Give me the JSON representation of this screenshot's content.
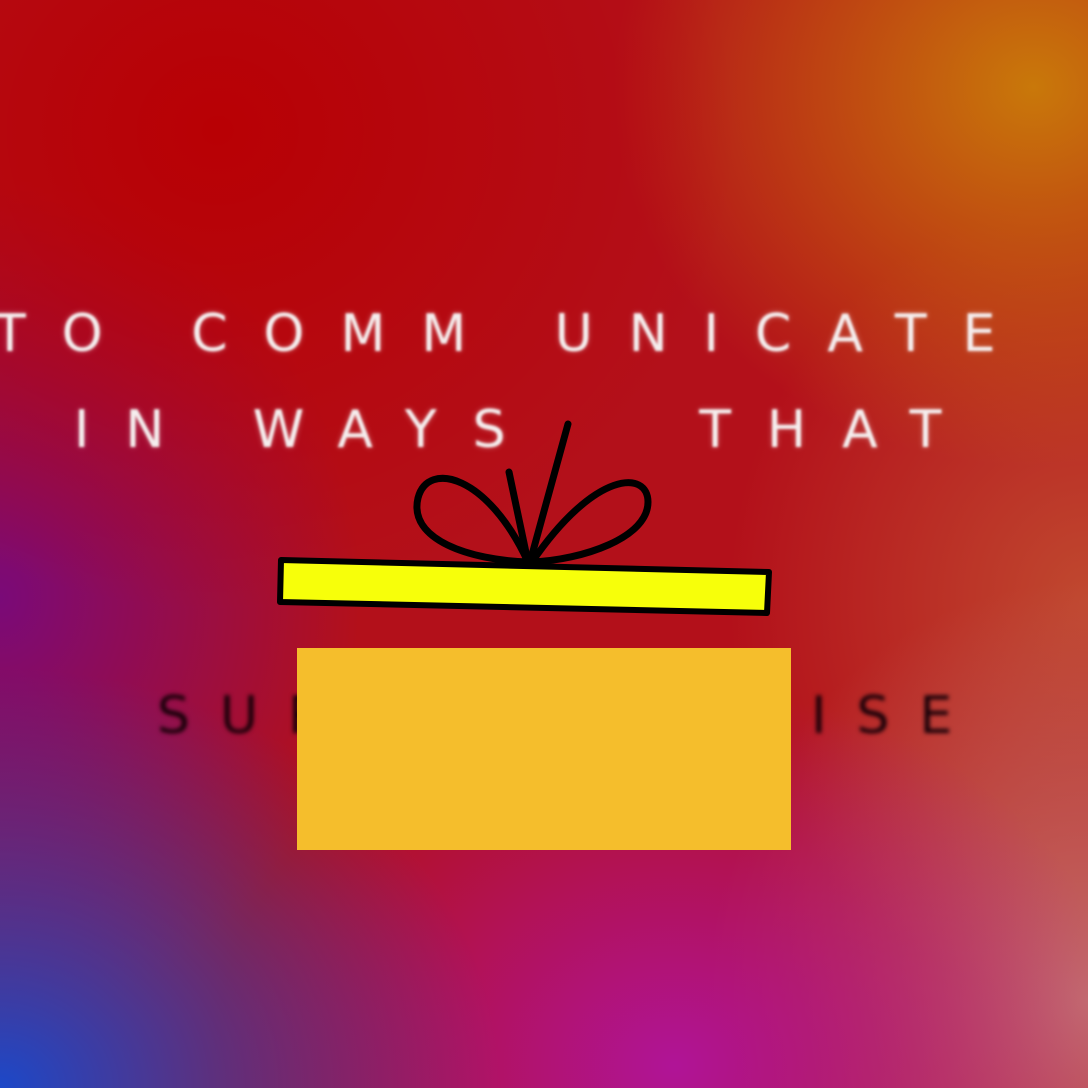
{
  "scene": {
    "line1": "TO COMM UNICATE",
    "line2": "IN WAYS   THAT",
    "word_left": "SURP",
    "word_right": "RISE"
  },
  "colors": {
    "background_top": "#b80004",
    "background_top_right": "#c9780a",
    "background_bottom_left": "#1c48c8",
    "background_bottom": "#b01497",
    "lid_fill": "#f7ff0a",
    "box_fill": "#f5be2c",
    "outline": "#000000",
    "text_white": "#f5eeee",
    "text_dark": "#150008"
  },
  "icons": [
    "gift-bow-icon",
    "gift-lid-icon",
    "gift-box-icon"
  ]
}
